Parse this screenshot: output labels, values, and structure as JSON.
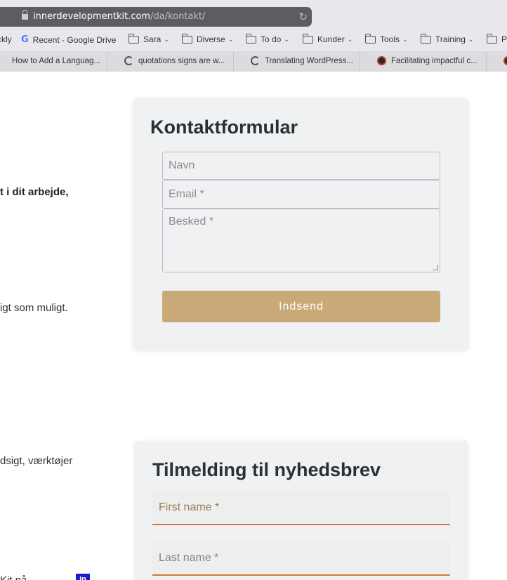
{
  "browser": {
    "url_domain": "innerdevelopmentkit.com",
    "url_path": "/da/kontakt/",
    "bookmarks": [
      {
        "label": "ckly",
        "icon": "none"
      },
      {
        "label": "Recent - Google Drive",
        "icon": "google-icon"
      },
      {
        "label": "Sara",
        "icon": "folder-icon"
      },
      {
        "label": "Diverse",
        "icon": "folder-icon"
      },
      {
        "label": "To do",
        "icon": "folder-icon"
      },
      {
        "label": "Kunder",
        "icon": "folder-icon"
      },
      {
        "label": "Tools",
        "icon": "folder-icon"
      },
      {
        "label": "Training",
        "icon": "folder-icon"
      },
      {
        "label": "P",
        "icon": "folder-icon"
      }
    ],
    "tabs": [
      {
        "label": "How to Add a Languag..."
      },
      {
        "label": "quotations signs are w..."
      },
      {
        "label": "Translating WordPress..."
      },
      {
        "label": "Facilitating impactful c..."
      }
    ]
  },
  "page": {
    "left_texts": {
      "line1": "t i dit arbejde,",
      "line2": "igt som muligt.",
      "line3": "dsigt, værktøjer",
      "line4": "Kit på"
    },
    "contact_form": {
      "title": "Kontaktformular",
      "name_placeholder": "Navn",
      "email_placeholder": "Email *",
      "message_placeholder": "Besked *",
      "submit_label": "Indsend"
    },
    "newsletter_form": {
      "title": "Tilmelding til nyhedsbrev",
      "first_name_placeholder": "First name *",
      "last_name_placeholder": "Last name *"
    },
    "social_icon": "in"
  },
  "colors": {
    "submit_button": "#c8a977",
    "field_underline": "#d17a3f",
    "card_background": "#f0f1f2",
    "linkedin": "#1a1ad1"
  }
}
